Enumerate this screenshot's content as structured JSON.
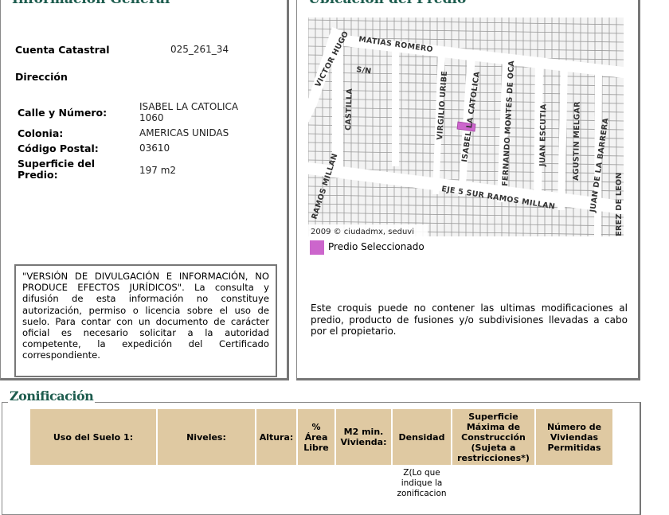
{
  "general": {
    "title": "Información General",
    "cuenta_label": "Cuenta Catastral",
    "cuenta_value": "025_261_34",
    "direccion_label": "Dirección",
    "calle_label": "Calle y Número:",
    "calle_value_1": "ISABEL LA CATOLICA",
    "calle_value_2": "1060",
    "colonia_label": "Colonia:",
    "colonia_value": "AMERICAS UNIDAS",
    "cp_label": "Código Postal:",
    "cp_value": "03610",
    "superficie_label_1": "Superficie del",
    "superficie_label_2": "Predio:",
    "superficie_value": "197 m2",
    "disclaimer": "\"VERSIÓN DE DIVULGACIÓN E INFORMACIÓN, NO PRODUCE EFECTOS JURÍDICOS\". La consulta y difusión de esta información no constituye autorización, permiso o licencia sobre el uso de suelo. Para contar con un documento de carácter oficial es necesario solicitar a la autoridad competente, la expedición del Certificado correspondiente."
  },
  "ubicacion": {
    "title": "Ubicación del Predio",
    "streets": {
      "matias": "MATIAS ROMERO",
      "victor": "VICTOR HUGO",
      "sn": "S/N",
      "castilla": "CASTILLA",
      "virgilio": "VIRGILIO URIBE",
      "isabel": "ISABEL LA CATOLICA",
      "fernando": "FERNANDO MONTES DE OCA",
      "escutia": "JUAN ESCUTIA",
      "melgar": "AGUSTIN MELGAR",
      "barrera": "JUAN DE LA BARRERA",
      "perez": "PEREZ DE LEON",
      "eje5": "EJE 5 SUR RAMOS MILLAN",
      "ramos": "RAMOS MILLAN"
    },
    "copyright": "2009 © ciudadmx, seduvi",
    "legend_label": "Predio Seleccionado",
    "legend_color": "#cc66cc",
    "note": "Este croquis puede no contener las ultimas modificaciones al predio, producto de fusiones y/o subdivisiones llevadas a cabo por el propietario."
  },
  "zonificacion": {
    "title": "Zonificación",
    "headers": [
      "Uso del Suelo 1:",
      "Niveles:",
      "Altura:",
      "% Área Libre",
      "M2 min. Vivienda:",
      "Densidad",
      "Superficie Máxima de Construcción (Sujeta a restricciones*)",
      "Número de Viviendas Permitidas"
    ],
    "row": [
      "",
      "",
      "",
      "",
      "",
      "Z(Lo que indique la zonificacion",
      "",
      ""
    ]
  }
}
